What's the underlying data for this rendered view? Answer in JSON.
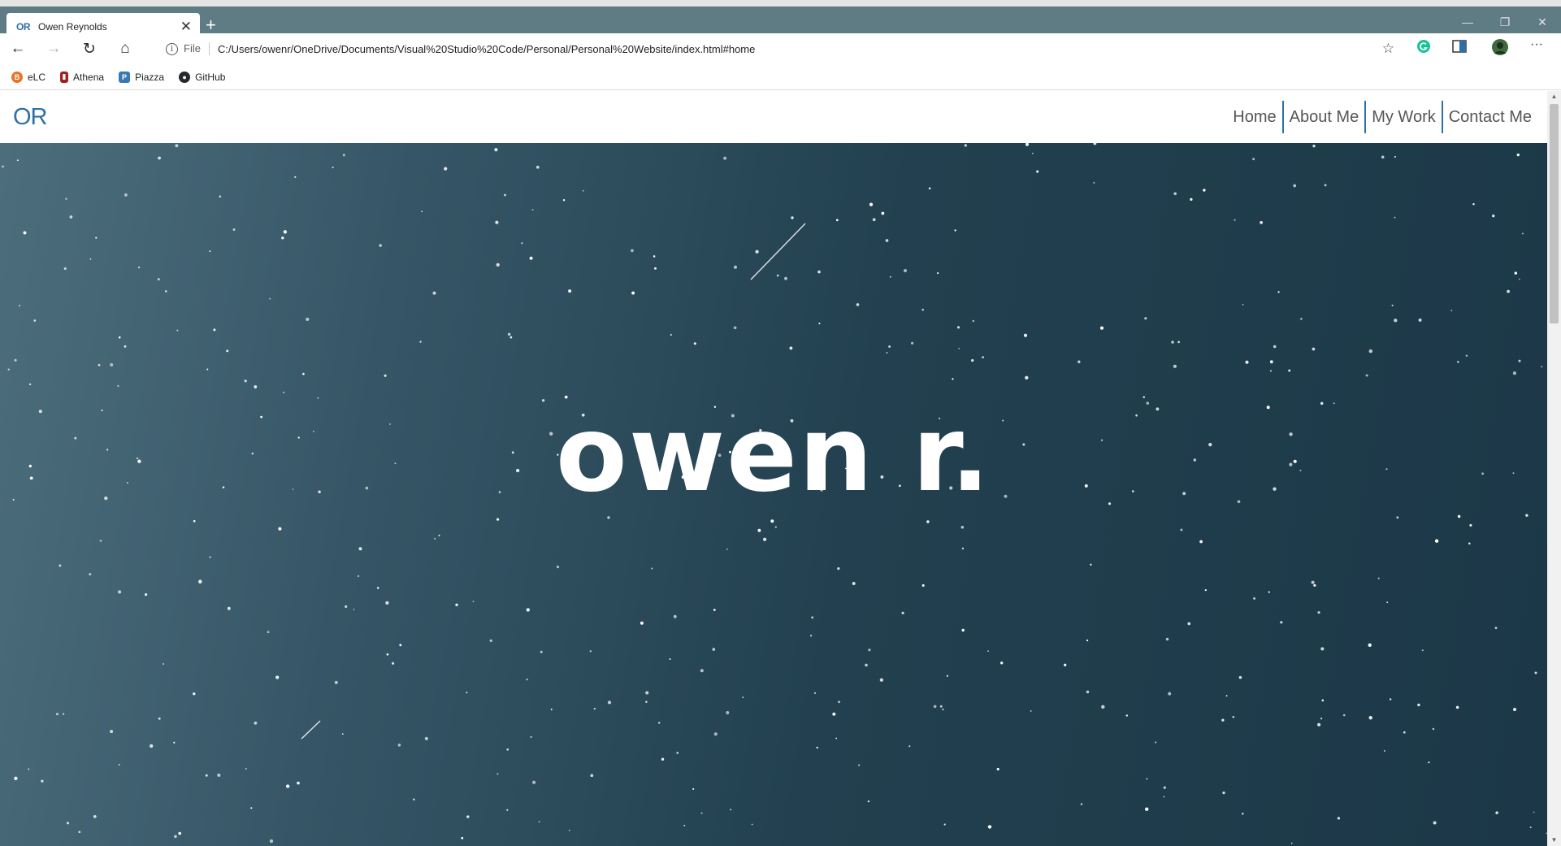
{
  "browser": {
    "tab": {
      "favicon_text": "OR",
      "title": "Owen Reynolds",
      "close": "✕"
    },
    "new_tab": "+",
    "window_controls": {
      "minimize": "—",
      "restore": "❐",
      "close": "✕"
    },
    "nav": {
      "back": "←",
      "forward": "→",
      "reload": "↻",
      "home": "⌂"
    },
    "address": {
      "scheme_label": "File",
      "url": "C:/Users/owenr/OneDrive/Documents/Visual%20Studio%20Code/Personal/Personal%20Website/index.html#home"
    },
    "bookmarks": [
      {
        "label": "eLC",
        "icon": "elc-icon",
        "color": "#e8742c"
      },
      {
        "label": "Athena",
        "icon": "athena-icon",
        "color": "#a02020"
      },
      {
        "label": "Piazza",
        "icon": "piazza-icon",
        "color": "#3a78b5"
      },
      {
        "label": "GitHub",
        "icon": "github-icon",
        "color": "#24292e"
      }
    ],
    "menu": "···"
  },
  "site": {
    "logo": "OR",
    "nav": [
      "Home",
      "About Me",
      "My Work",
      "Contact Me"
    ],
    "hero_title": "owen r."
  },
  "colors": {
    "brand": "#2f6fa8",
    "chrome": "#5f7b83",
    "hero_dark": "#1c3848",
    "hero_light": "#4c6e7c"
  }
}
